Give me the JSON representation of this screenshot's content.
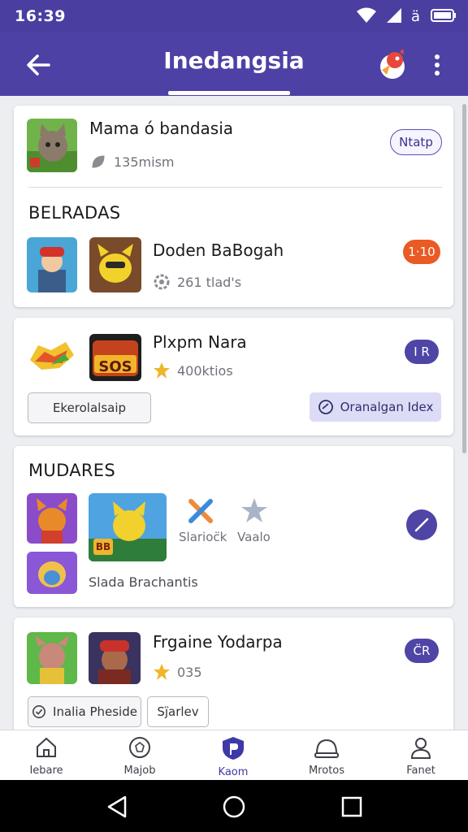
{
  "status_bar": {
    "time": "16:39"
  },
  "app_bar": {
    "title": "Inedangsia"
  },
  "card1": {
    "name": "Mama ó bandasia",
    "meta": "135mism",
    "action_label": "Ntatp",
    "section_title": "BELRADAS",
    "item_name": "Doden BaBogah",
    "item_meta": "261 tlad's",
    "item_badge": "1·10"
  },
  "card2": {
    "name": "Plxpm Nara",
    "meta": "400ktios",
    "badge": "I R",
    "logo_text": "SOS",
    "button_left": "Ekerolalsaip",
    "button_right": "Oranalgan Idex"
  },
  "card3": {
    "section_title": "MUDARES",
    "label_a": "Slarioc̈k",
    "label_b": "Vaalo",
    "caption": "Slada Brachantis",
    "game_tag": "BB"
  },
  "card4": {
    "name": "Frgaine Yodarpa",
    "meta": "035",
    "badge": "C̈R",
    "button_left": "Inalia Pheside",
    "button_right": "Sj̈arlev"
  },
  "bottom_nav": [
    {
      "label": "Iebare",
      "icon": "home-icon"
    },
    {
      "label": "Majob",
      "icon": "badge-icon"
    },
    {
      "label": "Kaom",
      "icon": "shield-icon",
      "active": true
    },
    {
      "label": "Mrotos",
      "icon": "helmet-icon"
    },
    {
      "label": "Fanet",
      "icon": "person-icon"
    }
  ],
  "colors": {
    "primary": "#4d41a6",
    "accent_orange": "#ea5a24",
    "active_nav": "#3e39a8"
  }
}
